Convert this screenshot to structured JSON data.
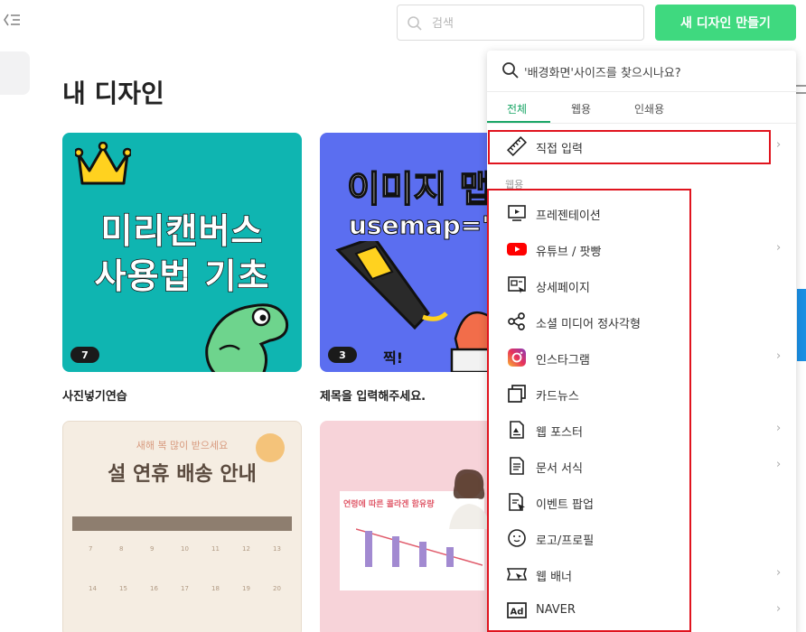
{
  "header": {
    "search_placeholder": "검색",
    "create_label": "새 디자인 만들기"
  },
  "page_title": "내 디자인",
  "cards": [
    {
      "title": "사진넣기연습",
      "badge": "7",
      "lines": [
        "미리캔버스",
        "사용법 기초"
      ]
    },
    {
      "title": "제목을 입력해주세요.",
      "badge": "3",
      "lines": [
        "이미지 맵",
        "usemap=\""
      ]
    },
    {
      "title": "",
      "lines": [
        "새해 복 많이 받으세요",
        "설 연휴 배송 안내"
      ]
    },
    {
      "title": "",
      "lines": [
        "연령에 따른 콜라겐 함유량"
      ]
    }
  ],
  "popup": {
    "search_text": "'배경화면'사이즈를 찾으시나요?",
    "tabs": [
      "전체",
      "웹용",
      "인쇄용"
    ],
    "direct_input": "직접 입력",
    "section_web": "웹용",
    "items": [
      {
        "label": "프레젠테이션",
        "icon": "presentation-icon",
        "chevron": false
      },
      {
        "label": "유튜브 / 팟빵",
        "icon": "youtube-icon",
        "chevron": true
      },
      {
        "label": "상세페이지",
        "icon": "detail-page-icon",
        "chevron": false
      },
      {
        "label": "소셜 미디어 정사각형",
        "icon": "share-icon",
        "chevron": false
      },
      {
        "label": "인스타그램",
        "icon": "instagram-icon",
        "chevron": true
      },
      {
        "label": "카드뉴스",
        "icon": "card-news-icon",
        "chevron": false
      },
      {
        "label": "웹 포스터",
        "icon": "poster-icon",
        "chevron": true
      },
      {
        "label": "문서 서식",
        "icon": "document-icon",
        "chevron": true
      },
      {
        "label": "이벤트 팝업",
        "icon": "event-popup-icon",
        "chevron": false
      },
      {
        "label": "로고/프로필",
        "icon": "logo-profile-icon",
        "chevron": false
      },
      {
        "label": "웹 배너",
        "icon": "banner-icon",
        "chevron": true
      },
      {
        "label": "NAVER",
        "icon": "naver-ad-icon",
        "chevron": true
      }
    ]
  },
  "colors": {
    "accent_green": "#3fd97f",
    "tab_green": "#1aa666",
    "highlight_red": "#e0141e"
  }
}
